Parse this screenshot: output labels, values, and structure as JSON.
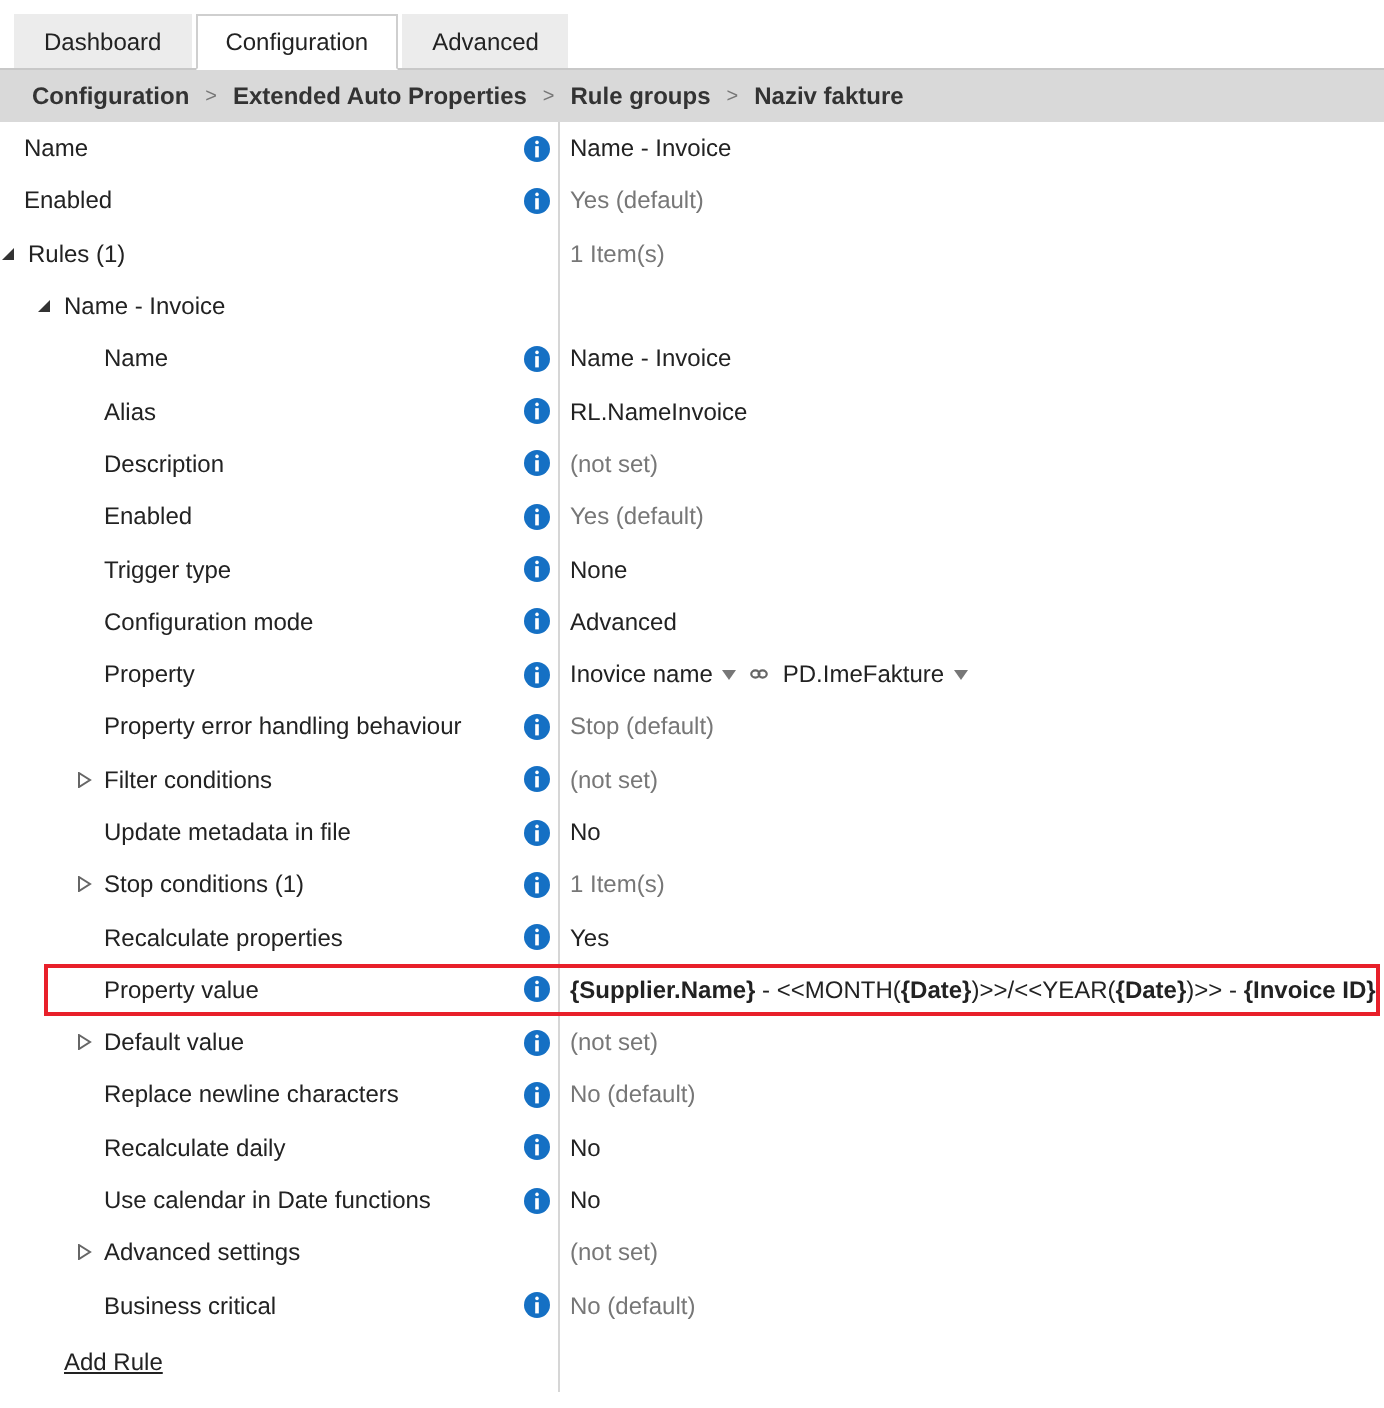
{
  "tabs": [
    {
      "label": "Dashboard",
      "selected": false
    },
    {
      "label": "Configuration",
      "selected": true
    },
    {
      "label": "Advanced",
      "selected": false
    }
  ],
  "breadcrumb": {
    "separator": ">",
    "items": [
      "Configuration",
      "Extended Auto Properties",
      "Rule groups",
      "Naziv fakture"
    ]
  },
  "rows": [
    {
      "label": "Name",
      "info": true,
      "value": "Name - Invoice",
      "muted": false
    },
    {
      "label": "Enabled",
      "info": true,
      "value": "Yes (default)",
      "muted": true
    },
    {
      "label": "Rules (1)",
      "info": false,
      "value": "1 Item(s)",
      "muted": true,
      "expanded": true,
      "children": [
        {
          "label": "Name - Invoice",
          "info": false,
          "expanded": true,
          "children": [
            {
              "label": "Name",
              "info": true,
              "value": "Name - Invoice",
              "muted": false
            },
            {
              "label": "Alias",
              "info": true,
              "value": "RL.NameInvoice",
              "muted": false
            },
            {
              "label": "Description",
              "info": true,
              "value": "(not set)",
              "muted": true
            },
            {
              "label": "Enabled",
              "info": true,
              "value": "Yes (default)",
              "muted": true
            },
            {
              "label": "Trigger type",
              "info": true,
              "value": "None",
              "muted": false
            },
            {
              "label": "Configuration mode",
              "info": true,
              "value": "Advanced",
              "muted": false
            },
            {
              "label": "Property",
              "info": true,
              "kind": "mapping",
              "source": "Inovice name",
              "target": "PD.ImeFakture"
            },
            {
              "label": "Property error handling behaviour",
              "info": true,
              "value": "Stop (default)",
              "muted": true
            },
            {
              "label": "Filter conditions",
              "info": true,
              "value": "(not set)",
              "muted": true,
              "expanded": false
            },
            {
              "label": "Update metadata in file",
              "info": true,
              "value": "No",
              "muted": false
            },
            {
              "label": "Stop conditions (1)",
              "info": true,
              "value": "1 Item(s)",
              "muted": true,
              "expanded": false
            },
            {
              "label": "Recalculate properties",
              "info": true,
              "value": "Yes",
              "muted": false
            },
            {
              "label": "Property value",
              "info": true,
              "value": "**{Supplier.Name}** - <<MONTH(**{Date}**)>>/<<YEAR(**{Date}**)>> - **{Invoice ID}**",
              "muted": false,
              "highlighted": true
            },
            {
              "label": "Default value",
              "info": true,
              "value": "(not set)",
              "muted": true,
              "expanded": false
            },
            {
              "label": "Replace newline characters",
              "info": true,
              "value": "No (default)",
              "muted": true
            },
            {
              "label": "Recalculate daily",
              "info": true,
              "value": "No",
              "muted": false
            },
            {
              "label": "Use calendar in Date functions",
              "info": true,
              "value": "No",
              "muted": false
            },
            {
              "label": "Advanced settings",
              "info": false,
              "value": "(not set)",
              "muted": true,
              "expanded": false
            },
            {
              "label": "Business critical",
              "info": true,
              "value": "No (default)",
              "muted": true
            }
          ]
        }
      ]
    }
  ],
  "add_link": "Add Rule"
}
